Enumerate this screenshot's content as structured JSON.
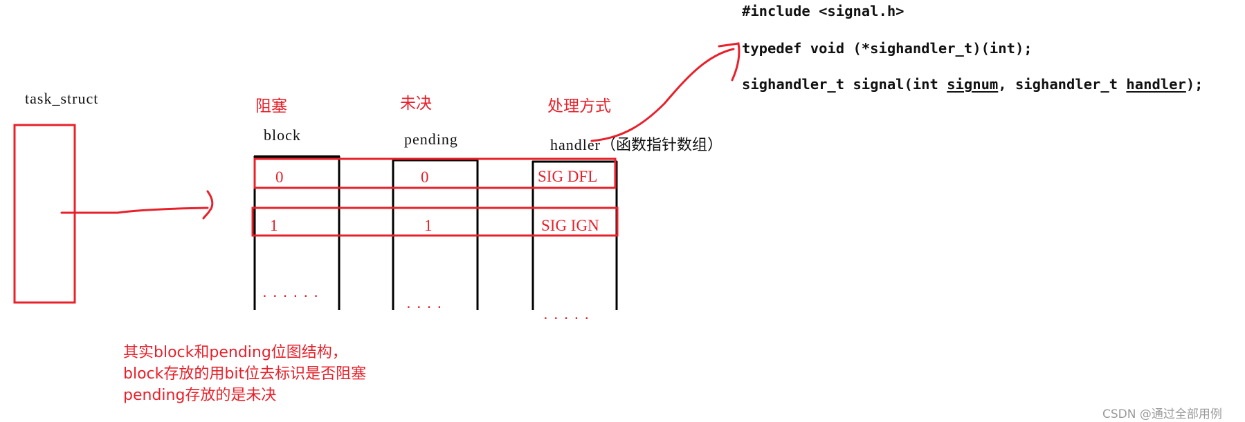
{
  "code": {
    "line1": "#include <signal.h>",
    "line2": "typedef void (*sighandler_t)(int);",
    "line3_prefix": "sighandler_t signal(int ",
    "line3_param1": "signum",
    "line3_mid": ", sighandler_t ",
    "line3_param2": "handler",
    "line3_suffix": ");"
  },
  "task_struct": {
    "label": "task_struct"
  },
  "columns": [
    {
      "cn_label": "阻塞",
      "en_label": "block",
      "values": [
        "0",
        "1"
      ],
      "ellipsis": "......"
    },
    {
      "cn_label": "未决",
      "en_label": "pending",
      "values": [
        "0",
        "1"
      ],
      "ellipsis": "...."
    },
    {
      "cn_label": "处理方式",
      "en_label": "handler",
      "en_note": "（函数指针数组）",
      "values": [
        "SIG DFL",
        "SIG IGN"
      ],
      "ellipsis": "....."
    }
  ],
  "note": {
    "lines": [
      "其实block和pending位图结构，",
      "block存放的用bit位去标识是否阻塞",
      "pending存放的是未决"
    ]
  },
  "watermark": "CSDN @通过全部用例",
  "colors": {
    "annotation_red": "#e8202a",
    "line_black": "#000000"
  }
}
